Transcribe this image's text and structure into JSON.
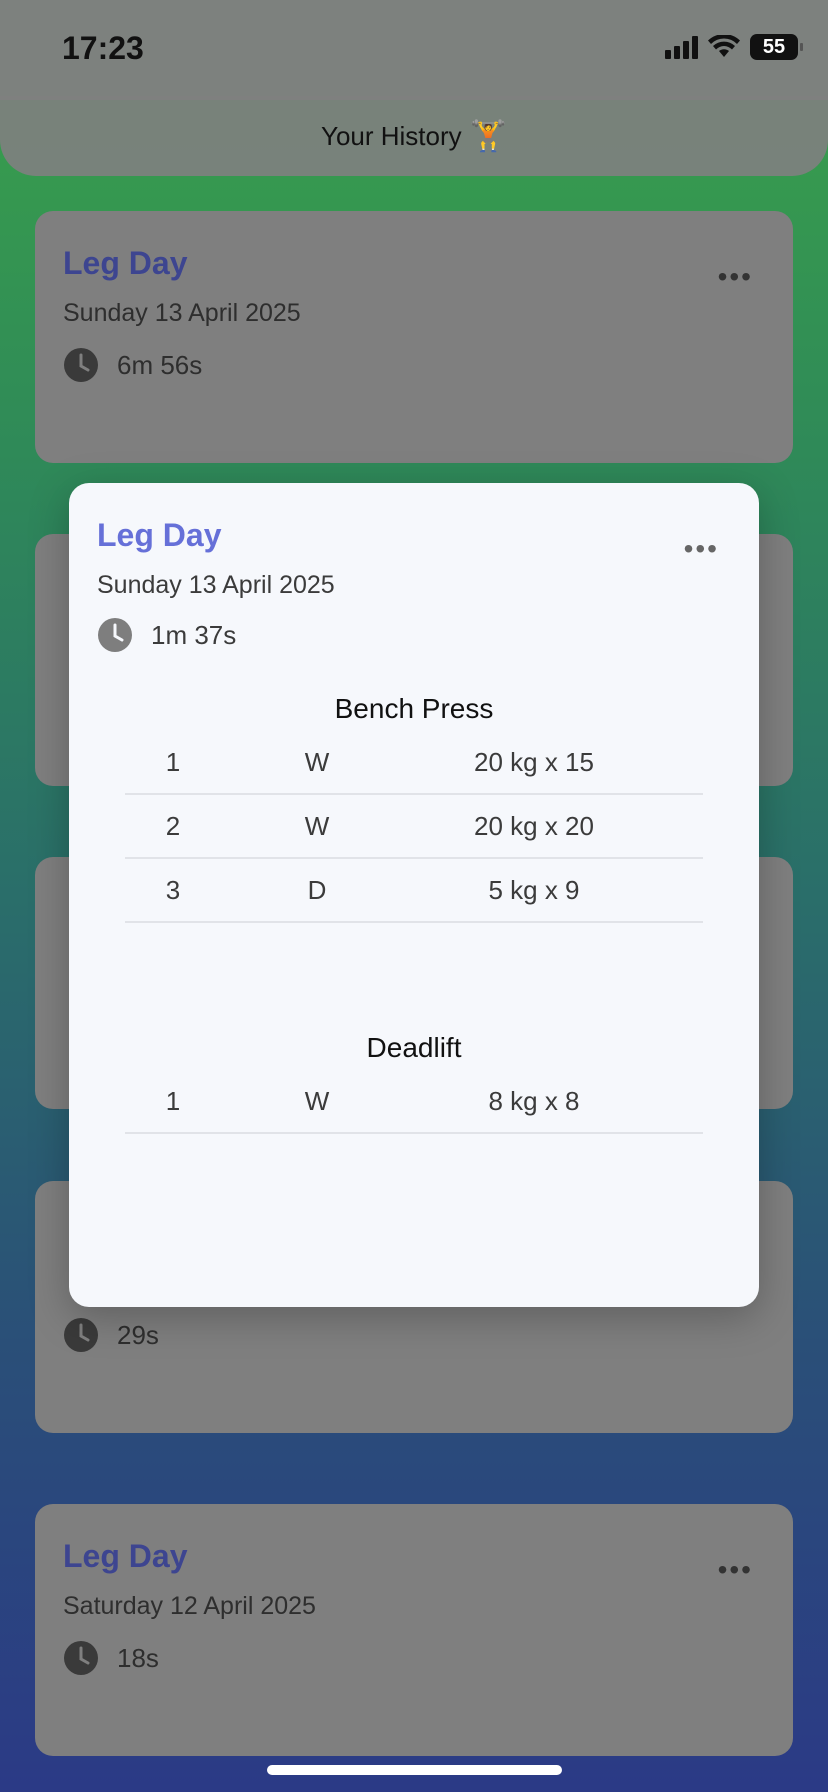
{
  "status_bar": {
    "time": "17:23",
    "battery": "55"
  },
  "header": {
    "title": "Your History",
    "icon": "🏋️"
  },
  "cards": [
    {
      "title": "Leg Day",
      "date": "Sunday 13 April 2025",
      "duration": "6m 56s",
      "more": "•••"
    },
    {
      "title": "",
      "date": "",
      "duration": "",
      "more": ""
    },
    {
      "title": "",
      "date": "",
      "duration": "",
      "more": ""
    },
    {
      "title": "",
      "date": "",
      "duration": "29s",
      "more": ""
    },
    {
      "title": "Leg Day",
      "date": "Saturday 12 April 2025",
      "duration": "18s",
      "more": "•••"
    }
  ],
  "modal": {
    "title": "Leg Day",
    "date": "Sunday 13 April 2025",
    "duration": "1m 37s",
    "more": "•••",
    "exercises": [
      {
        "name": "Bench Press",
        "sets": [
          {
            "num": "1",
            "type": "W",
            "detail": "20 kg x 15"
          },
          {
            "num": "2",
            "type": "W",
            "detail": "20 kg x 20"
          },
          {
            "num": "3",
            "type": "D",
            "detail": "5 kg x 9"
          }
        ]
      },
      {
        "name": "Deadlift",
        "sets": [
          {
            "num": "1",
            "type": "W",
            "detail": "8 kg x 8"
          }
        ]
      }
    ]
  },
  "colors": {
    "title_accent": "#6670d8",
    "card_bg": "#7f7f7f",
    "modal_bg": "#f6f8fc"
  }
}
